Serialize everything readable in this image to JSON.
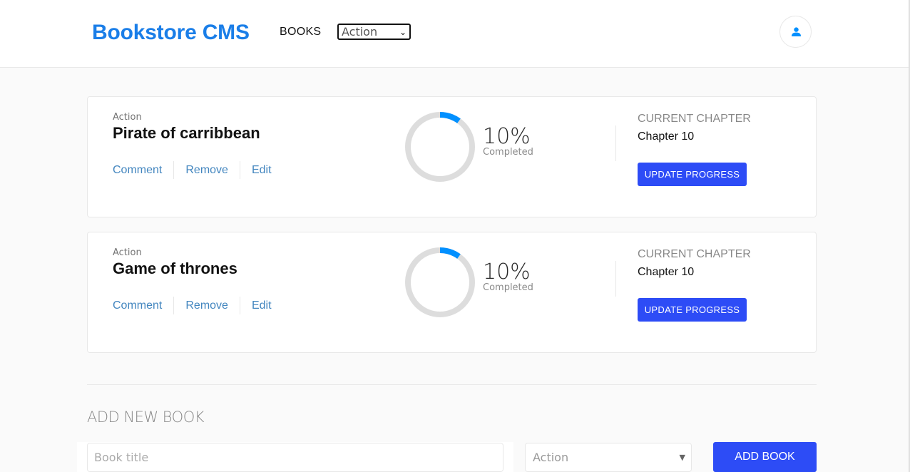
{
  "header": {
    "logo": "Bookstore CMS",
    "nav_books": "BOOKS",
    "category_filter": "Action",
    "user_icon": "user-icon"
  },
  "books": [
    {
      "genre": "Action",
      "title": "Pirate of carribbean",
      "actions": {
        "comment": "Comment",
        "remove": "Remove",
        "edit": "Edit"
      },
      "progress_percent": 10,
      "progress_text": "10%",
      "progress_label": "Completed",
      "current_chapter_label": "CURRENT CHAPTER",
      "current_chapter": "Chapter 10",
      "update_label": "UPDATE PROGRESS"
    },
    {
      "genre": "Action",
      "title": "Game of thrones",
      "actions": {
        "comment": "Comment",
        "remove": "Remove",
        "edit": "Edit"
      },
      "progress_percent": 10,
      "progress_text": "10%",
      "progress_label": "Completed",
      "current_chapter_label": "CURRENT CHAPTER",
      "current_chapter": "Chapter 10",
      "update_label": "UPDATE PROGRESS"
    }
  ],
  "add_form": {
    "heading": "ADD NEW BOOK",
    "title_placeholder": "Book title",
    "genre_placeholder": "Action",
    "submit_label": "ADD BOOK"
  },
  "colors": {
    "brand": "#1a7ee8",
    "button": "#2d4cf6",
    "link": "#4386bf",
    "progress": "#0290ff",
    "ring_track": "#dddddd"
  }
}
